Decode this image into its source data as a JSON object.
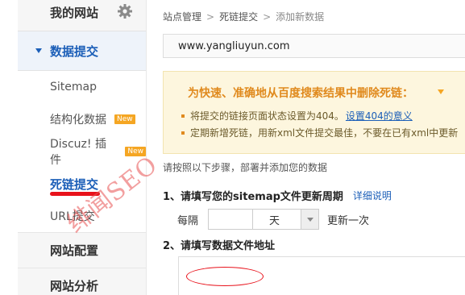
{
  "sidebar": {
    "my_sites": "我的网站",
    "gear_icon": "gear-icon",
    "section_submit": "数据提交",
    "items": [
      {
        "label": "Sitemap",
        "badge": ""
      },
      {
        "label": "结构化数据",
        "badge": "New"
      },
      {
        "label": "Discuz! 插件",
        "badge": "New"
      },
      {
        "label": "死链提交",
        "badge": "",
        "active": true
      },
      {
        "label": "URL提交",
        "badge": ""
      }
    ],
    "group_config": "网站配置",
    "group_analysis": "网站分析"
  },
  "breadcrumb": {
    "items": [
      "站点管理",
      "死链提交",
      "添加新数据"
    ],
    "separator": ">"
  },
  "site_select": {
    "value": "www.yangliuyun.com"
  },
  "notice": {
    "title": "为快速、准确地从百度搜索结果中删除死链：",
    "line1_text": "将提交的链接页面状态设置为404。",
    "line1_link": "设置404的意义",
    "line2_text": "定期新增死链，用新xml文件提交最佳，不要在已有xml中更新",
    "bg_color": "#fdf6de",
    "title_color": "#e08a1e"
  },
  "instructions": "请按照以下步骤，部署并添加您的数据",
  "step1": {
    "label": "1、请填写您的sitemap文件更新周期",
    "detail_link": "详细说明",
    "prefix": "每隔",
    "number_value": "",
    "unit_value": "天",
    "suffix": "更新一次"
  },
  "step2": {
    "label": "2、请填写数据文件地址",
    "url_value": ""
  },
  "watermark": "绯闻SEO",
  "colors": {
    "accent_blue": "#1c5fb8",
    "highlight_red": "#e8121b",
    "badge_orange": "#f5a623"
  }
}
